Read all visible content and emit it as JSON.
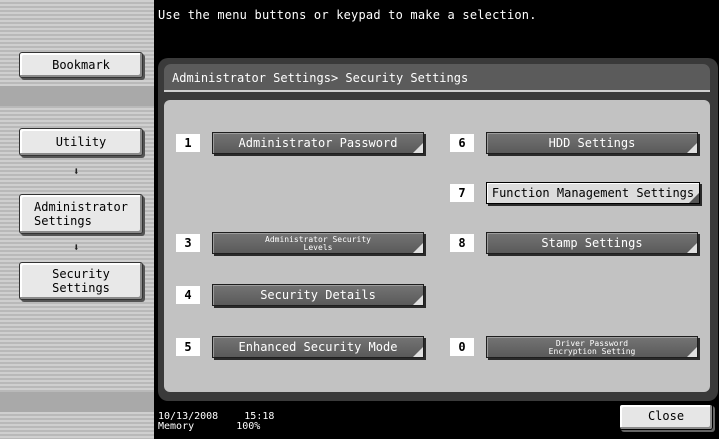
{
  "header": {
    "message": "Use the menu buttons or keypad to make a selection."
  },
  "sidebar": {
    "bookmark_label": "Bookmark",
    "breadcrumbs": [
      {
        "label": "Utility"
      },
      {
        "label": "Administrator\nSettings"
      },
      {
        "label": "Security\nSettings"
      }
    ],
    "arrow_icon": "down-arrow-icon"
  },
  "panel": {
    "title": "Administrator Settings> Security Settings",
    "options": [
      {
        "key": "1",
        "label": "Administrator Password"
      },
      {
        "key": "3",
        "label_line1": "Administrator Security",
        "label_line2": "Levels"
      },
      {
        "key": "4",
        "label": "Security Details"
      },
      {
        "key": "5",
        "label": "Enhanced Security Mode"
      },
      {
        "key": "6",
        "label": "HDD Settings"
      },
      {
        "key": "7",
        "label": "Function Management Settings"
      },
      {
        "key": "8",
        "label": "Stamp Settings"
      },
      {
        "key": "0",
        "label_line1": "Driver Password",
        "label_line2": "Encryption Setting"
      }
    ]
  },
  "footer": {
    "date": "10/13/2008",
    "time": "15:18",
    "memory_label": "Memory",
    "memory_value": "100%",
    "close_label": "Close"
  }
}
